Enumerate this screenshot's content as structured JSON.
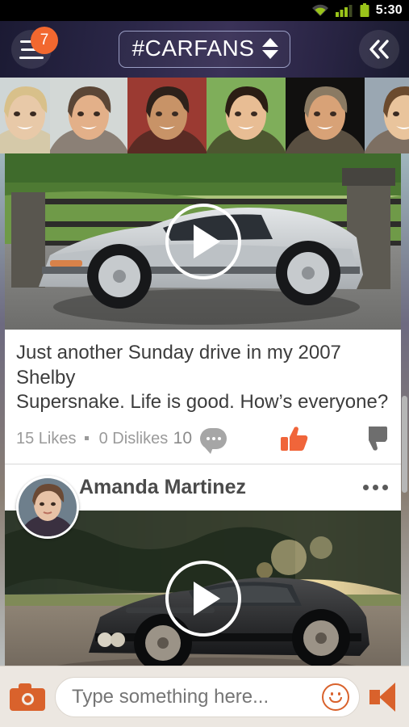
{
  "statusbar": {
    "clock": "5:30",
    "wifi_icon": "wifi-icon",
    "signal_icon": "signal-bars-icon",
    "battery_icon": "battery-icon"
  },
  "header": {
    "menu_icon": "hamburger-menu-icon",
    "notification_count": "7",
    "title": "#CARFANS",
    "spinner_icon": "up-down-arrows-icon",
    "collapse_icon": "double-chevron-left-icon",
    "accent": "#f2682f",
    "background": "#2b2748"
  },
  "friends_strip": {
    "label": "friend-avatars",
    "avatars": [
      {
        "name": "friend-avatar-1",
        "skin": "#e8c9a8",
        "hair": "#d8c08a",
        "bg": "#cfd6d6"
      },
      {
        "name": "friend-avatar-2",
        "skin": "#e3b089",
        "hair": "#5b4636",
        "bg": "#d3d8d6"
      },
      {
        "name": "friend-avatar-3",
        "skin": "#c89367",
        "hair": "#2e211a",
        "bg": "#9b3a32"
      },
      {
        "name": "friend-avatar-4",
        "skin": "#e8bd94",
        "hair": "#2b1d14",
        "bg": "#7fae5a"
      },
      {
        "name": "friend-avatar-5",
        "skin": "#d8a277",
        "hair": "#8a7a63",
        "bg": "#11100f"
      },
      {
        "name": "friend-avatar-6",
        "skin": "#e9c49c",
        "hair": "#6b4a2d",
        "bg": "#9aa7b2"
      },
      {
        "name": "friend-avatar-7",
        "skin": "#c79a70",
        "hair": "#3a3028",
        "bg": "#6f7c64"
      }
    ]
  },
  "feed": {
    "posts": [
      {
        "name": "post-shelby",
        "media_type": "video",
        "play_icon": "play-button-icon",
        "text": "Just another Sunday drive in my 2007 Shelby\nSupersnake.  Life is good.  How’s everyone?",
        "likes": "15 Likes",
        "dislikes": "0 Dislikes",
        "comment_count": "10",
        "comment_icon": "comment-bubble-icon",
        "like_icon": "thumbs-up-icon",
        "like_color": "#f0653a",
        "dislike_icon": "thumbs-down-icon",
        "dislike_color": "#6e6e6e"
      },
      {
        "name": "post-amanda",
        "author": "Amanda Martinez",
        "avatar_icon": "user-avatar",
        "overflow_icon": "more-options-icon",
        "media_type": "video",
        "play_icon": "play-button-icon"
      }
    ]
  },
  "composer": {
    "camera_icon": "camera-icon",
    "placeholder": "Type something here...",
    "value": "",
    "emoji_icon": "smiley-face-icon",
    "megaphone_icon": "speaker-megaphone-icon",
    "accent": "#d9622c"
  }
}
